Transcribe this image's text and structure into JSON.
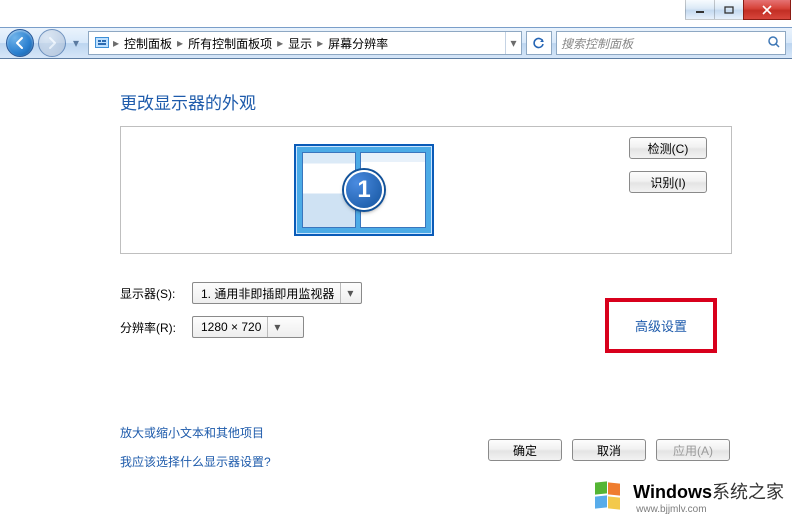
{
  "window": {
    "min": "—",
    "max": "□",
    "close": "×"
  },
  "nav": {
    "crumbs": [
      "控制面板",
      "所有控制面板项",
      "显示",
      "屏幕分辨率"
    ],
    "search_placeholder": "搜索控制面板"
  },
  "page": {
    "title": "更改显示器的外观"
  },
  "preview": {
    "monitor_number": "1",
    "detect_label": "检测(C)",
    "identify_label": "识别(I)"
  },
  "form": {
    "display_label": "显示器(S):",
    "display_value": "1. 通用非即插即用监视器",
    "resolution_label": "分辨率(R):",
    "resolution_value": "1280 × 720"
  },
  "links": {
    "advanced": "高级设置",
    "text_scaling": "放大或缩小文本和其他项目",
    "which_settings": "我应该选择什么显示器设置?"
  },
  "buttons": {
    "ok": "确定",
    "cancel": "取消",
    "apply": "应用(A)"
  },
  "watermark": {
    "brand": "Windows",
    "suffix": "系统之家",
    "url": "www.bjjmlv.com"
  }
}
